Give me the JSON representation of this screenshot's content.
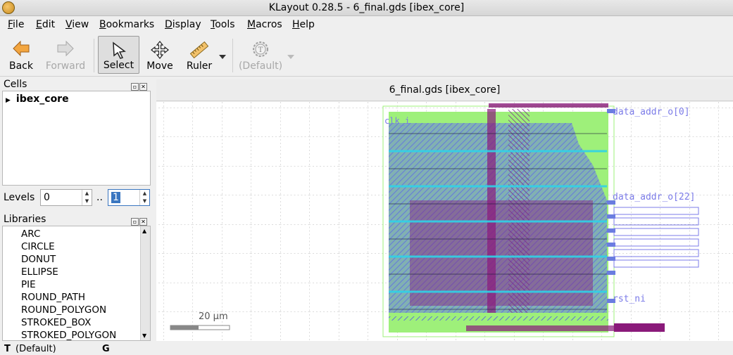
{
  "window": {
    "title": "KLayout 0.28.5 - 6_final.gds [ibex_core]"
  },
  "menu": [
    {
      "u": "F",
      "rest": "ile"
    },
    {
      "u": "E",
      "rest": "dit"
    },
    {
      "u": "V",
      "rest": "iew"
    },
    {
      "u": "B",
      "rest": "ookmarks"
    },
    {
      "u": "D",
      "rest": "isplay"
    },
    {
      "u": "T",
      "rest": "ools"
    },
    {
      "u": "M",
      "rest": "acros"
    },
    {
      "u": "H",
      "rest": "elp"
    }
  ],
  "toolbar": {
    "back": "Back",
    "forward": "Forward",
    "select": "Select",
    "move": "Move",
    "ruler": "Ruler",
    "default": "(Default)"
  },
  "cells": {
    "title": "Cells",
    "items": [
      "ibex_core"
    ]
  },
  "levels": {
    "label": "Levels",
    "from": "0",
    "sep": "..",
    "to": "1"
  },
  "libraries": {
    "title": "Libraries",
    "items": [
      "ARC",
      "CIRCLE",
      "DONUT",
      "ELLIPSE",
      "PIE",
      "ROUND_PATH",
      "ROUND_POLYGON",
      "STROKED_BOX",
      "STROKED_POLYGON"
    ]
  },
  "view": {
    "title": "6_final.gds [ibex_core]",
    "scale": "20 µm",
    "pin_labels": {
      "top": "data_addr_o[0]",
      "mid": "data_addr_o[22]",
      "bottom": "rst_ni",
      "left": "clk_i"
    }
  },
  "status": {
    "tool": "(Default)",
    "grid": "G"
  },
  "colors": {
    "bg_fill": "#9ef07a",
    "metal_blue": "#6a7de0",
    "metal_purple": "#8a1a7a",
    "cyan": "#2fd3e8",
    "label": "#7b7be8"
  }
}
